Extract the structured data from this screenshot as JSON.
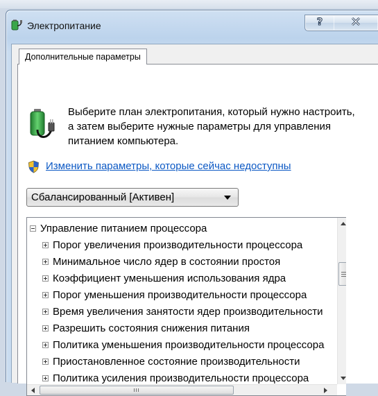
{
  "window": {
    "title": "Электропитание",
    "help_glyph": "?",
    "close_glyph": "✕"
  },
  "tab": {
    "label": "Дополнительные параметры"
  },
  "intro": {
    "icon": "power-plug-battery-icon",
    "text": "Выберите план электропитания, который нужно настроить, а затем выберите нужные параметры для управления питанием компьютера."
  },
  "link": {
    "icon": "uac-shield-icon",
    "text": "Изменить параметры, которые сейчас недоступны"
  },
  "plan_select": {
    "selected": "Сбалансированный [Активен]"
  },
  "tree": {
    "items": [
      {
        "label": "Управление питанием процессора",
        "expander": "minus",
        "level": 0
      },
      {
        "label": "Порог увеличения производительности процессора",
        "expander": "plus",
        "level": 1
      },
      {
        "label": "Минимальное число ядер в состоянии простоя",
        "expander": "plus",
        "level": 1
      },
      {
        "label": "Коэффициент уменьшения использования ядра",
        "expander": "plus",
        "level": 1
      },
      {
        "label": "Порог уменьшения производительности процессора",
        "expander": "plus",
        "level": 1
      },
      {
        "label": "Время увеличения занятости ядер производительности",
        "expander": "plus",
        "level": 1
      },
      {
        "label": "Разрешить состояния снижения питания",
        "expander": "plus",
        "level": 1
      },
      {
        "label": "Политика уменьшения производительности процессора",
        "expander": "plus",
        "level": 1
      },
      {
        "label": "Приостановленное состояние производительности",
        "expander": "plus",
        "level": 1
      },
      {
        "label": "Политика усиления производительности процессора",
        "expander": "plus",
        "level": 1
      }
    ]
  },
  "colors": {
    "link": "#0b58c4",
    "title_gradient_top": "#cfe0f2",
    "title_gradient_bottom": "#bcd3ec"
  }
}
